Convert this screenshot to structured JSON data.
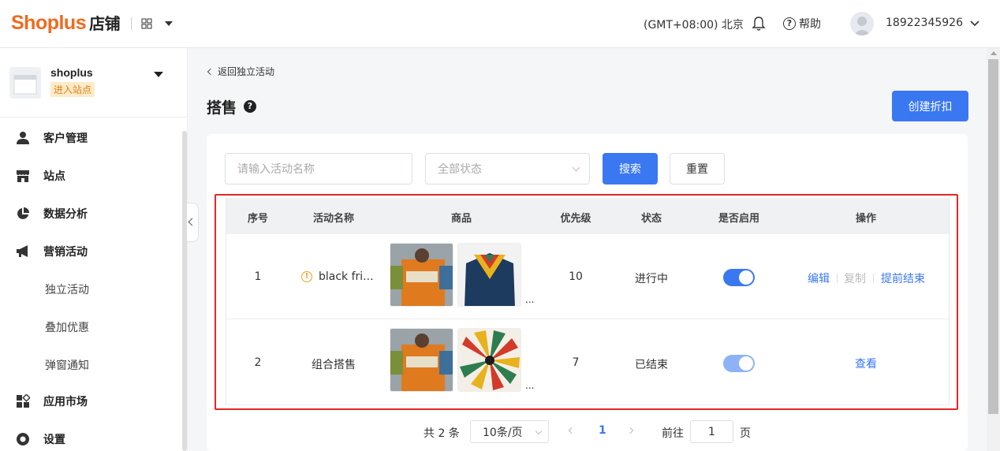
{
  "header": {
    "brand": "Shoplus",
    "brand_suffix": "店铺",
    "timezone": "(GMT+08:00) 北京",
    "help_label": "帮助",
    "phone": "18922345926"
  },
  "sidebar": {
    "shop_name": "shoplus",
    "enter_site": "进入站点",
    "items": [
      {
        "label": "客户管理",
        "icon": "user-icon"
      },
      {
        "label": "站点",
        "icon": "store-icon"
      },
      {
        "label": "数据分析",
        "icon": "pie-chart-icon"
      },
      {
        "label": "营销活动",
        "icon": "megaphone-icon"
      },
      {
        "label": "应用市场",
        "icon": "apps-icon"
      },
      {
        "label": "设置",
        "icon": "settings-icon"
      }
    ],
    "sub_items": [
      "独立活动",
      "叠加优惠",
      "弹窗通知"
    ]
  },
  "page": {
    "back_label": "返回独立活动",
    "title": "搭售",
    "create_button": "创建折扣"
  },
  "filters": {
    "name_placeholder": "请输入活动名称",
    "status_placeholder": "全部状态",
    "search_button": "搜索",
    "reset_button": "重置"
  },
  "table": {
    "columns": [
      "序号",
      "活动名称",
      "商品",
      "优先级",
      "状态",
      "是否启用",
      "操作"
    ],
    "rows": [
      {
        "index": "1",
        "name": "black fri...",
        "priority": "10",
        "status": "进行中",
        "enabled": true,
        "ops": [
          "编辑",
          "复制",
          "提前结束"
        ],
        "more": "..."
      },
      {
        "index": "2",
        "name": "组合搭售",
        "priority": "7",
        "status": "已结束",
        "enabled": true,
        "ops": [
          "查看"
        ],
        "more": "..."
      }
    ]
  },
  "pagination": {
    "total": "共 2 条",
    "page_size": "10条/页",
    "current": "1",
    "goto_label": "前往",
    "goto_value": "1",
    "page_suffix": "页"
  },
  "colors": {
    "accent": "#3a78f2",
    "brand": "#f06a1e",
    "highlight": "#e52626"
  }
}
